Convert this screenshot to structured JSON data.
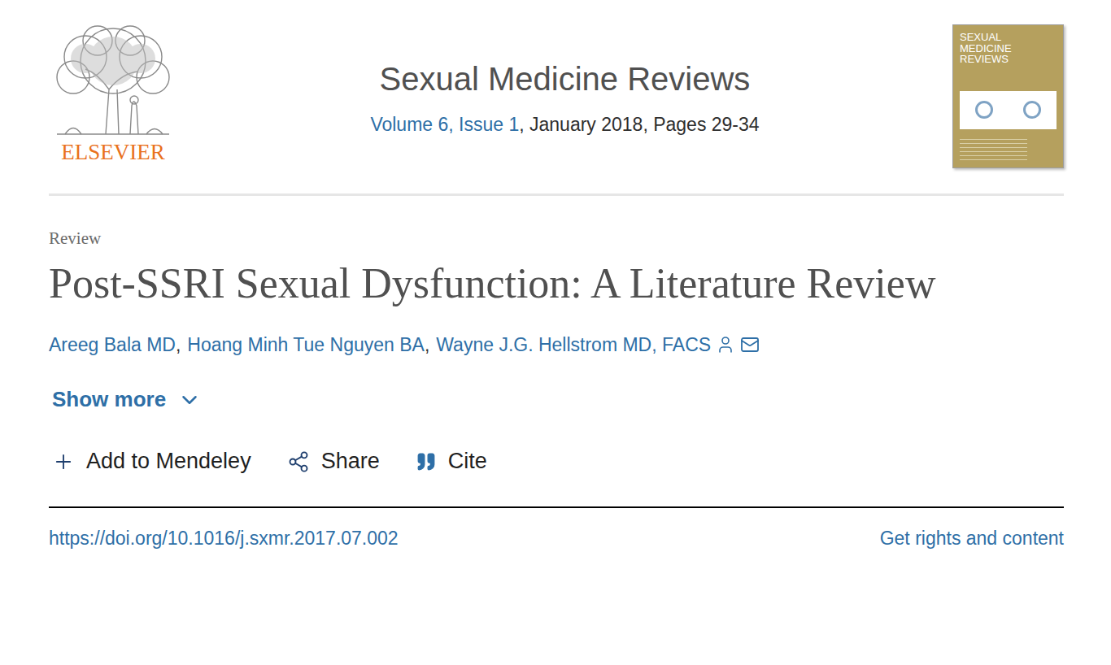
{
  "logo": {
    "wordmark": "ELSEVIER"
  },
  "journal": {
    "name": "Sexual Medicine Reviews",
    "issue_link": "Volume 6, Issue 1",
    "issue_details": ", January 2018, Pages 29-34"
  },
  "cover": {
    "title": "SEXUAL MEDICINE REVIEWS"
  },
  "article": {
    "type": "Review",
    "title": "Post-SSRI Sexual Dysfunction: A Literature Review",
    "separator": ",",
    "authors": [
      {
        "name": "Areeg Bala MD",
        "corresponding": false
      },
      {
        "name": "Hoang Minh Tue Nguyen BA",
        "corresponding": false
      },
      {
        "name": "Wayne J.G. Hellstrom MD, FACS",
        "corresponding": true
      }
    ]
  },
  "show_more": {
    "label": "Show more",
    "expanded": false
  },
  "actions": [
    {
      "label": "Add to Mendeley",
      "kind": "add"
    },
    {
      "label": "Share",
      "kind": "share"
    },
    {
      "label": "Cite",
      "kind": "cite"
    }
  ],
  "footer": {
    "doi": "https://doi.org/10.1016/j.sxmr.2017.07.002",
    "rights": "Get rights and content"
  }
}
